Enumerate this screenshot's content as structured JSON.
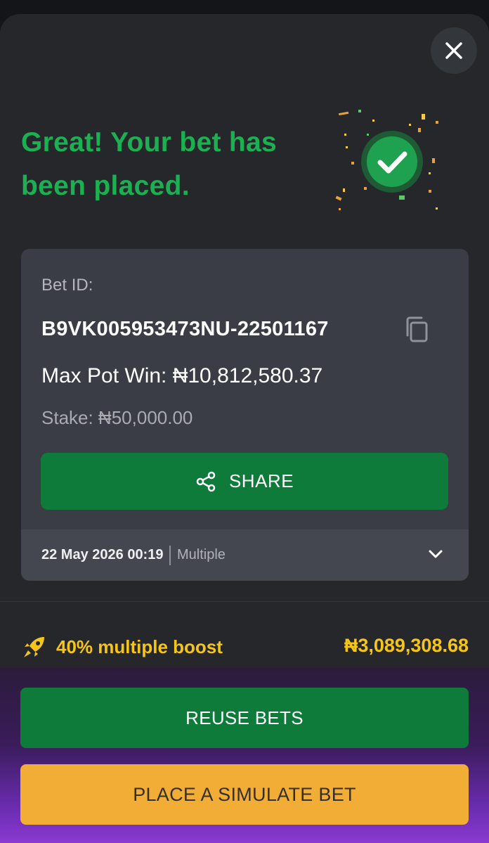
{
  "headline": {
    "line1": "Great! Your bet has",
    "line2": "been placed."
  },
  "bet": {
    "id_label": "Bet ID:",
    "id_value": "B9VK005953473NU-22501167",
    "max_win": "Max Pot Win: ₦10,812,580.37",
    "stake": "Stake: ₦50,000.00",
    "share_label": "SHARE",
    "date": "22 May 2026 00:19",
    "type": "Multiple"
  },
  "boost": {
    "label": "40% multiple boost",
    "value": "₦3,089,308.68"
  },
  "actions": {
    "reuse_label": "REUSE BETS",
    "simulate_label": "PLACE A SIMULATE BET"
  },
  "icons": {
    "close": "close-icon",
    "success": "check-badge-icon",
    "copy": "copy-icon",
    "share": "share-icon",
    "expand": "chevron-down-icon",
    "boost": "rocket-icon"
  },
  "colors": {
    "primary_green": "#0f7b3a",
    "headline_green": "#1bb052",
    "boost_yellow": "#f5c518",
    "simulate_orange": "#f2ad36"
  }
}
